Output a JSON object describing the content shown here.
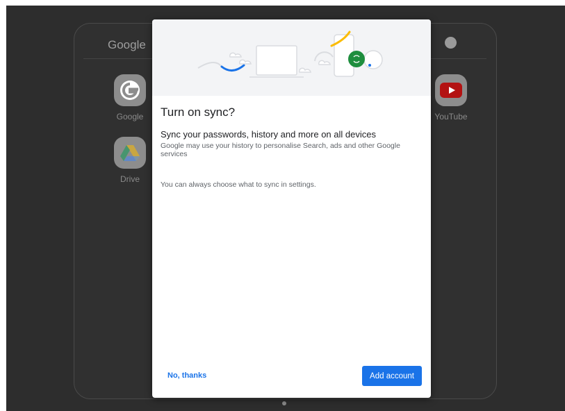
{
  "launcher": {
    "folder_title": "Google",
    "apps": [
      {
        "label": "Google",
        "icon": "google-icon"
      },
      {
        "label": "Drive",
        "icon": "drive-icon"
      },
      {
        "label": "YouTube",
        "icon": "youtube-icon"
      }
    ]
  },
  "dialog": {
    "title": "Turn on sync?",
    "subtitle": "Sync your passwords, history and more on all devices",
    "description": "Google may use your history to personalise Search, ads and other Google services",
    "note": "You can always choose what to sync in settings.",
    "secondary_button": "No, thanks",
    "primary_button": "Add account"
  },
  "colors": {
    "accent": "#1a73e8",
    "backdrop": "#2d2d2d",
    "illustration_bg": "#f3f4f6"
  }
}
